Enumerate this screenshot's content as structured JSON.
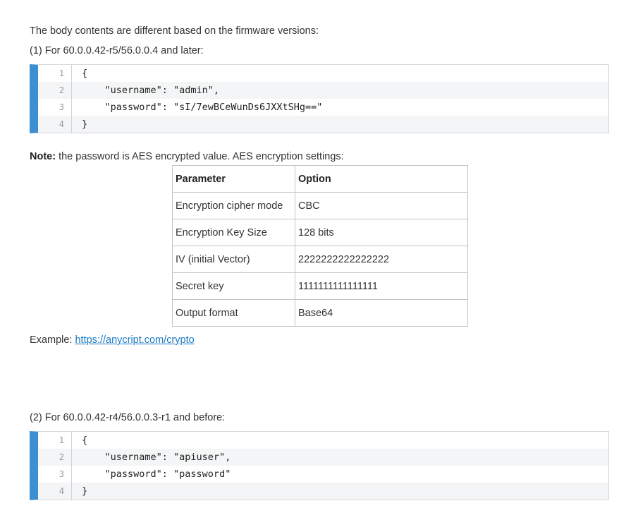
{
  "intro": "The body contents are different based on the firmware versions:",
  "section1": {
    "heading": "(1) For 60.0.0.42-r5/56.0.0.4 and later:",
    "code": [
      {
        "num": "1",
        "text": "{"
      },
      {
        "num": "2",
        "text": "    \"username\": \"admin\","
      },
      {
        "num": "3",
        "text": "    \"password\": \"sI/7ewBCeWunDs6JXXtSHg==\""
      },
      {
        "num": "4",
        "text": "}"
      }
    ]
  },
  "note": {
    "label": "Note:",
    "text": " the password is AES encrypted value. AES encryption settings:"
  },
  "table": {
    "headers": [
      "Parameter",
      "Option"
    ],
    "rows": [
      [
        "Encryption cipher mode",
        "CBC"
      ],
      [
        "Encryption Key Size",
        "128 bits"
      ],
      [
        "IV (initial Vector)",
        "2222222222222222"
      ],
      [
        "Secret key",
        "1111111111111111"
      ],
      [
        "Output format",
        "Base64"
      ]
    ]
  },
  "example": {
    "label": "Example: ",
    "link": "https://anycript.com/crypto"
  },
  "section2": {
    "heading": "(2) For 60.0.0.42-r4/56.0.0.3-r1 and before:",
    "code": [
      {
        "num": "1",
        "text": "{"
      },
      {
        "num": "2",
        "text": "    \"username\": \"apiuser\","
      },
      {
        "num": "3",
        "text": "    \"password\": \"password\""
      },
      {
        "num": "4",
        "text": "}"
      }
    ]
  }
}
